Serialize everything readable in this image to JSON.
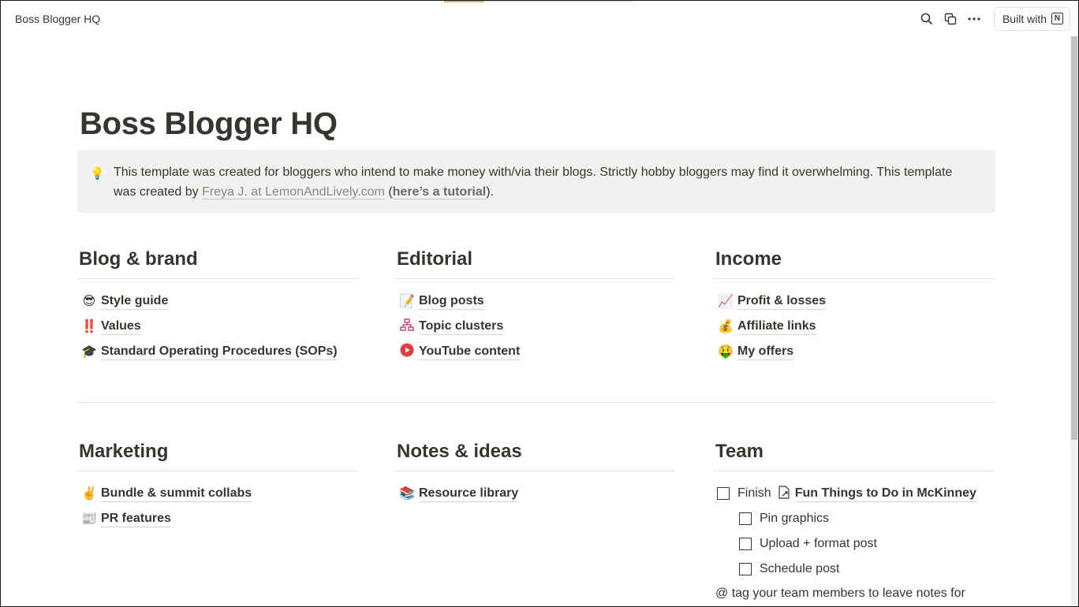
{
  "topbar": {
    "breadcrumb": "Boss Blogger HQ",
    "built_with_label": "Built with",
    "notion_glyph": "N",
    "icons": [
      "search-icon",
      "duplicate-icon",
      "more-icon"
    ]
  },
  "page": {
    "title": "Boss Blogger HQ",
    "callout": {
      "icon": "💡",
      "text_before": "This template was created for bloggers who intend to make money with/via their blogs. Strictly hobby bloggers may find it overwhelming. This template was created by ",
      "author_link": "Freya J. at LemonAndLively.com",
      "text_middle": " (",
      "tutorial_link": "here’s a tutorial",
      "text_after": ")."
    }
  },
  "sections": {
    "blog_brand": {
      "title": "Blog & brand",
      "items": [
        {
          "icon": "😎",
          "label": "Style guide"
        },
        {
          "icon": "‼️",
          "label": "Values"
        },
        {
          "icon": "🎓",
          "label": "Standard Operating Procedures (SOPs)"
        }
      ]
    },
    "editorial": {
      "title": "Editorial",
      "items": [
        {
          "icon": "📝",
          "label": "Blog posts"
        },
        {
          "icon": "🔗",
          "label": "Topic clusters"
        },
        {
          "icon": "▶",
          "label": "YouTube content"
        }
      ]
    },
    "income": {
      "title": "Income",
      "items": [
        {
          "icon": "📈",
          "label": "Profit & losses"
        },
        {
          "icon": "💰",
          "label": "Affiliate links"
        },
        {
          "icon": "🤑",
          "label": "My offers"
        }
      ]
    },
    "marketing": {
      "title": "Marketing",
      "items": [
        {
          "icon": "✌️",
          "label": "Bundle & summit collabs"
        },
        {
          "icon": "📰",
          "label": "PR features"
        }
      ]
    },
    "notes": {
      "title": "Notes & ideas",
      "items": [
        {
          "icon": "📚",
          "label": "Resource library"
        }
      ]
    },
    "team": {
      "title": "Team",
      "todo_main_prefix": "Finish",
      "todo_main_link": "Fun Things to Do in McKinney",
      "subtodos": [
        "Pin graphics",
        "Upload + format post",
        "Schedule post"
      ],
      "note": "@ tag your team members to leave notes for"
    }
  },
  "colors": {
    "text": "#37352f",
    "callout_bg": "#f1f1ef",
    "divider": "#e3e2df",
    "youtube_red": "#e03e3e",
    "topic_pink": "#c14c8a"
  }
}
